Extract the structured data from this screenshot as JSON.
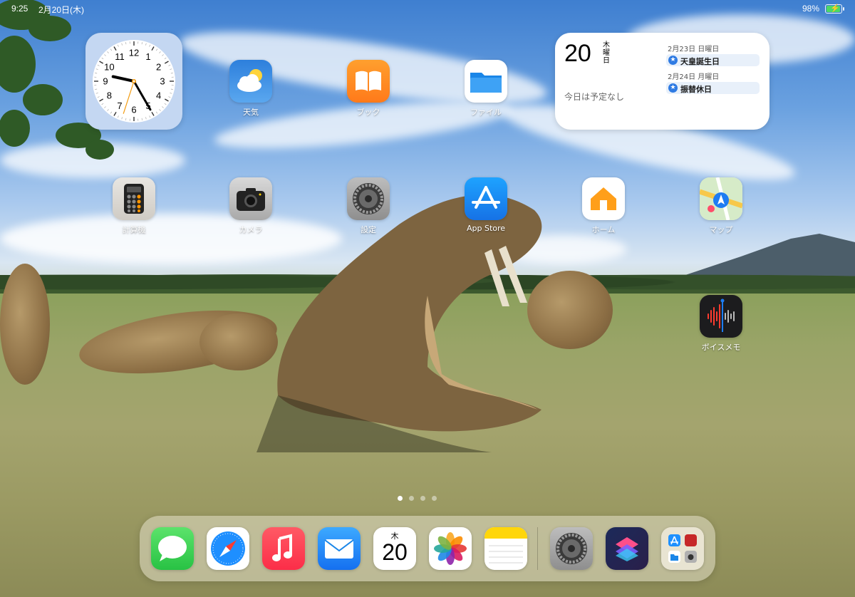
{
  "status_bar": {
    "time": "9:25",
    "date": "2月20日(木)",
    "battery": "98%",
    "battery_level": 0.98
  },
  "clock_widget": {
    "hour": 9,
    "minute": 25,
    "second": 33
  },
  "calendar_widget": {
    "day": "20",
    "weekday": "木曜日",
    "no_events": "今日は予定なし",
    "events": [
      {
        "date": "2月23日 日曜日",
        "title": "天皇誕生日"
      },
      {
        "date": "2月24日 月曜日",
        "title": "振替休日"
      }
    ]
  },
  "home_apps": [
    {
      "name": "weather-app",
      "label": "天気",
      "icon": "weather-icon"
    },
    {
      "name": "books-app",
      "label": "ブック",
      "icon": "book-icon"
    },
    {
      "name": "files-app",
      "label": "ファイル",
      "icon": "folder-icon"
    },
    {
      "name": "calculator-app",
      "label": "計算機",
      "icon": "calculator-icon"
    },
    {
      "name": "camera-app",
      "label": "カメラ",
      "icon": "camera-icon"
    },
    {
      "name": "settings-app",
      "label": "設定",
      "icon": "gear-icon"
    },
    {
      "name": "app-store-app",
      "label": "App Store",
      "icon": "app-store-icon"
    },
    {
      "name": "home-app",
      "label": "ホーム",
      "icon": "house-icon"
    },
    {
      "name": "maps-app",
      "label": "マップ",
      "icon": "map-icon"
    },
    {
      "name": "voice-memos-app",
      "label": "ボイスメモ",
      "icon": "waveform-icon"
    }
  ],
  "page_dots": {
    "count": 4,
    "active": 0
  },
  "dock": {
    "apps": [
      {
        "name": "messages",
        "icon": "speech-bubble-icon",
        "color": "#34c759"
      },
      {
        "name": "safari",
        "icon": "compass-icon",
        "color": "#1e90ff"
      },
      {
        "name": "music",
        "icon": "music-note-icon",
        "color": "#fc3c44"
      },
      {
        "name": "mail",
        "icon": "envelope-icon",
        "color": "#1a8cff"
      },
      {
        "name": "calendar",
        "icon": "calendar-icon",
        "weekday": "木",
        "day": "20"
      },
      {
        "name": "photos",
        "icon": "pinwheel-icon"
      },
      {
        "name": "notes",
        "icon": "notepad-icon",
        "color": "#ffd60a"
      },
      {
        "name": "settings",
        "icon": "gear-icon"
      },
      {
        "name": "shortcuts",
        "icon": "shortcuts-icon"
      },
      {
        "name": "app-library",
        "icon": "app-library-icon"
      }
    ]
  }
}
